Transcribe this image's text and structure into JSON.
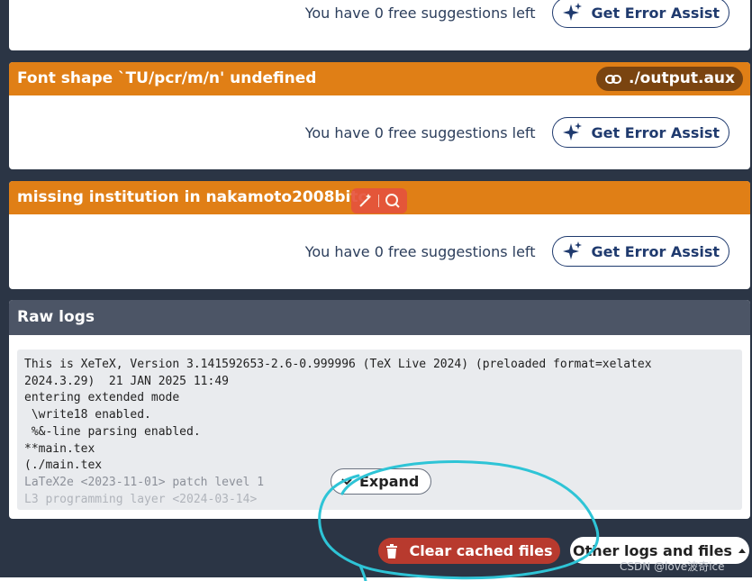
{
  "cards": [
    {
      "header": "",
      "suggestions_text": "You have 0 free suggestions left",
      "assist_label": "Get Error Assist"
    },
    {
      "header": "Font shape `TU/pcr/m/n' undefined",
      "file_badge": "./output.aux",
      "suggestions_text": "You have 0 free suggestions left",
      "assist_label": "Get Error Assist"
    },
    {
      "header": "missing institution in nakamoto2008bitc",
      "suggestions_text": "You have 0 free suggestions left",
      "assist_label": "Get Error Assist"
    }
  ],
  "raw_logs": {
    "title": "Raw logs",
    "lines": [
      "This is XeTeX, Version 3.141592653-2.6-0.999996 (TeX Live 2024) (preloaded format=xelatex",
      "2024.3.29)  21 JAN 2025 11:49",
      "entering extended mode",
      " \\write18 enabled.",
      " %&-line parsing enabled.",
      "**main.tex",
      "(./main.tex",
      "LaTeX2e <2023-11-01> patch level 1",
      "L3 programming layer <2024-03-14>"
    ],
    "expand_label": "Expand"
  },
  "actions": {
    "clear_label": "Clear cached files",
    "other_label": "Other logs and files"
  },
  "watermark": "CSDN @love波奇ice",
  "colors": {
    "warning_header": "#e07f16",
    "file_badge": "#7a4410",
    "assist_border": "#1f3a6e",
    "background": "#2b3545",
    "raw_header": "#4c5566",
    "clear_button": "#b83a2e",
    "annotation_stroke": "#2ec4d6"
  },
  "icons": {
    "assist": "sparkle-icon",
    "file_badge": "link-icon",
    "expand": "chevron-down-icon",
    "clear": "trash-icon",
    "other": "caret-up-icon"
  }
}
